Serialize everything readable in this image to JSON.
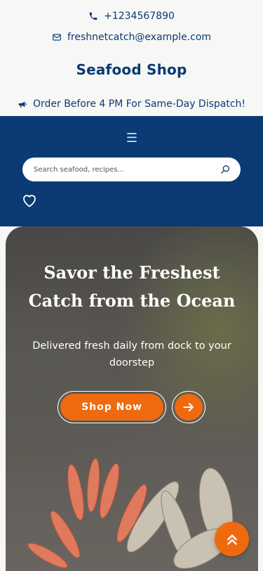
{
  "header": {
    "phone": "+1234567890",
    "email": "freshnetcatch@example.com",
    "brand": "Seafood Shop",
    "promo": "Order Before 4 PM For Same-Day Dispatch!"
  },
  "nav": {
    "menu_icon": "☰",
    "search_placeholder": "Search seafood, recipes..."
  },
  "hero": {
    "title": "Savor the Freshest Catch from the Ocean",
    "subtitle": "Delivered fresh daily from dock to your doorstep",
    "cta_label": "Shop Now"
  },
  "colors": {
    "navy": "#0b3a74",
    "accent": "#ef6a0f",
    "background": "#f7f7f5"
  },
  "icons": [
    "phone-icon",
    "mail-icon",
    "megaphone-icon",
    "menu-icon",
    "search-icon",
    "heart-icon",
    "arrow-right-icon",
    "chevron-double-up-icon"
  ]
}
